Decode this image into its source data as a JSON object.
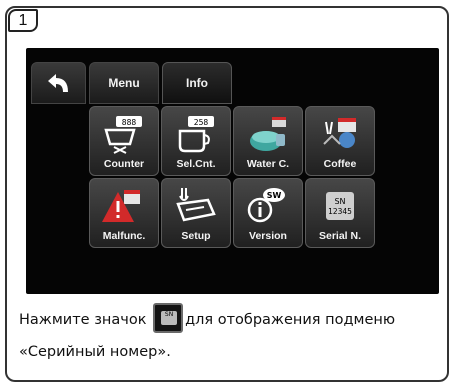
{
  "step": {
    "number": "1"
  },
  "screen": {
    "tabs": {
      "back_icon": "back-arrow-icon",
      "menu_label": "Menu",
      "info_label": "Info"
    },
    "tiles": [
      {
        "label": "Counter",
        "icon": "counter-icon"
      },
      {
        "label": "Sel.Cnt.",
        "icon": "selection-counter-icon"
      },
      {
        "label": "Water C.",
        "icon": "water-filter-icon"
      },
      {
        "label": "Coffee",
        "icon": "coffee-icon"
      },
      {
        "label": "Malfunc.",
        "icon": "malfunction-warning-icon"
      },
      {
        "label": "Setup",
        "icon": "setup-machine-icon"
      },
      {
        "label": "Version",
        "icon": "software-version-icon"
      },
      {
        "label": "Serial N.",
        "icon": "serial-number-icon"
      }
    ],
    "icon_texts": {
      "counter_digits": "888",
      "selcnt_digits": "258",
      "sw_badge": "SW",
      "serial_sn": "SN",
      "serial_digits": "12345"
    }
  },
  "caption": {
    "before": "Нажмите значок ",
    "after_part1": "для отображения подменю",
    "after_part2": "«Серийный номер».",
    "inline_icon": "serial-number-icon",
    "inline_icon_text": "SN"
  },
  "colors": {
    "accent_red": "#d22a2a",
    "screen_bg": "#050505",
    "tile_bg": "#3a3a3a"
  }
}
